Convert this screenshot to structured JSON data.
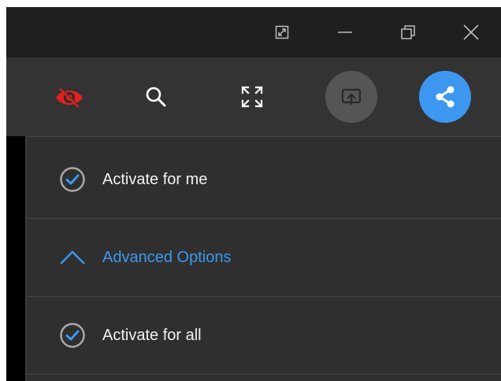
{
  "titlebar": {
    "buttons": [
      {
        "name": "restore-size-icon"
      },
      {
        "name": "minimize-icon"
      },
      {
        "name": "maximize-icon"
      },
      {
        "name": "close-icon"
      }
    ]
  },
  "toolbar": {
    "items": [
      {
        "name": "eye-icon",
        "color": "#e02020"
      },
      {
        "name": "search-icon"
      },
      {
        "name": "fullscreen-icon"
      },
      {
        "name": "cast-icon",
        "state": "disabled",
        "bg": "#555555"
      },
      {
        "name": "share-icon",
        "state": "active",
        "bg": "#3d97f0"
      }
    ]
  },
  "options": {
    "activate_me": "Activate for me",
    "advanced": "Advanced Options",
    "activate_all": "Activate for all"
  },
  "colors": {
    "accent": "#3d97f0",
    "brand_eye": "#e02020"
  }
}
